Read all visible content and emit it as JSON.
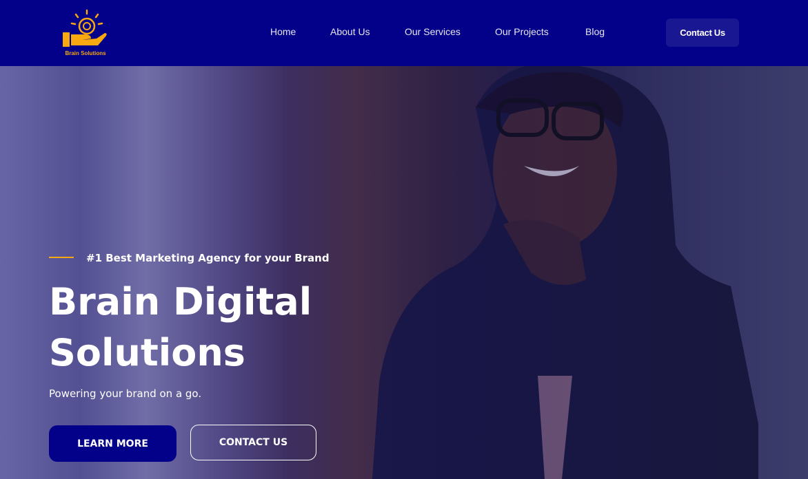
{
  "brand": {
    "name": "Brain Solutions",
    "accent": "#f7a90f",
    "nav_bg": "#03008a"
  },
  "nav": {
    "items": [
      {
        "label": "Home"
      },
      {
        "label": "About Us"
      },
      {
        "label": "Our Services"
      },
      {
        "label": "Our Projects"
      },
      {
        "label": "Blog"
      }
    ],
    "cta": "Contact Us"
  },
  "hero": {
    "eyebrow": "#1 Best Marketing Agency for your Brand",
    "title_line1": "Brain Digital",
    "title_line2": "Solutions",
    "subtitle": "Powering your brand on a go.",
    "primary_button": "LEARN MORE",
    "secondary_button": "CONTACT US"
  }
}
